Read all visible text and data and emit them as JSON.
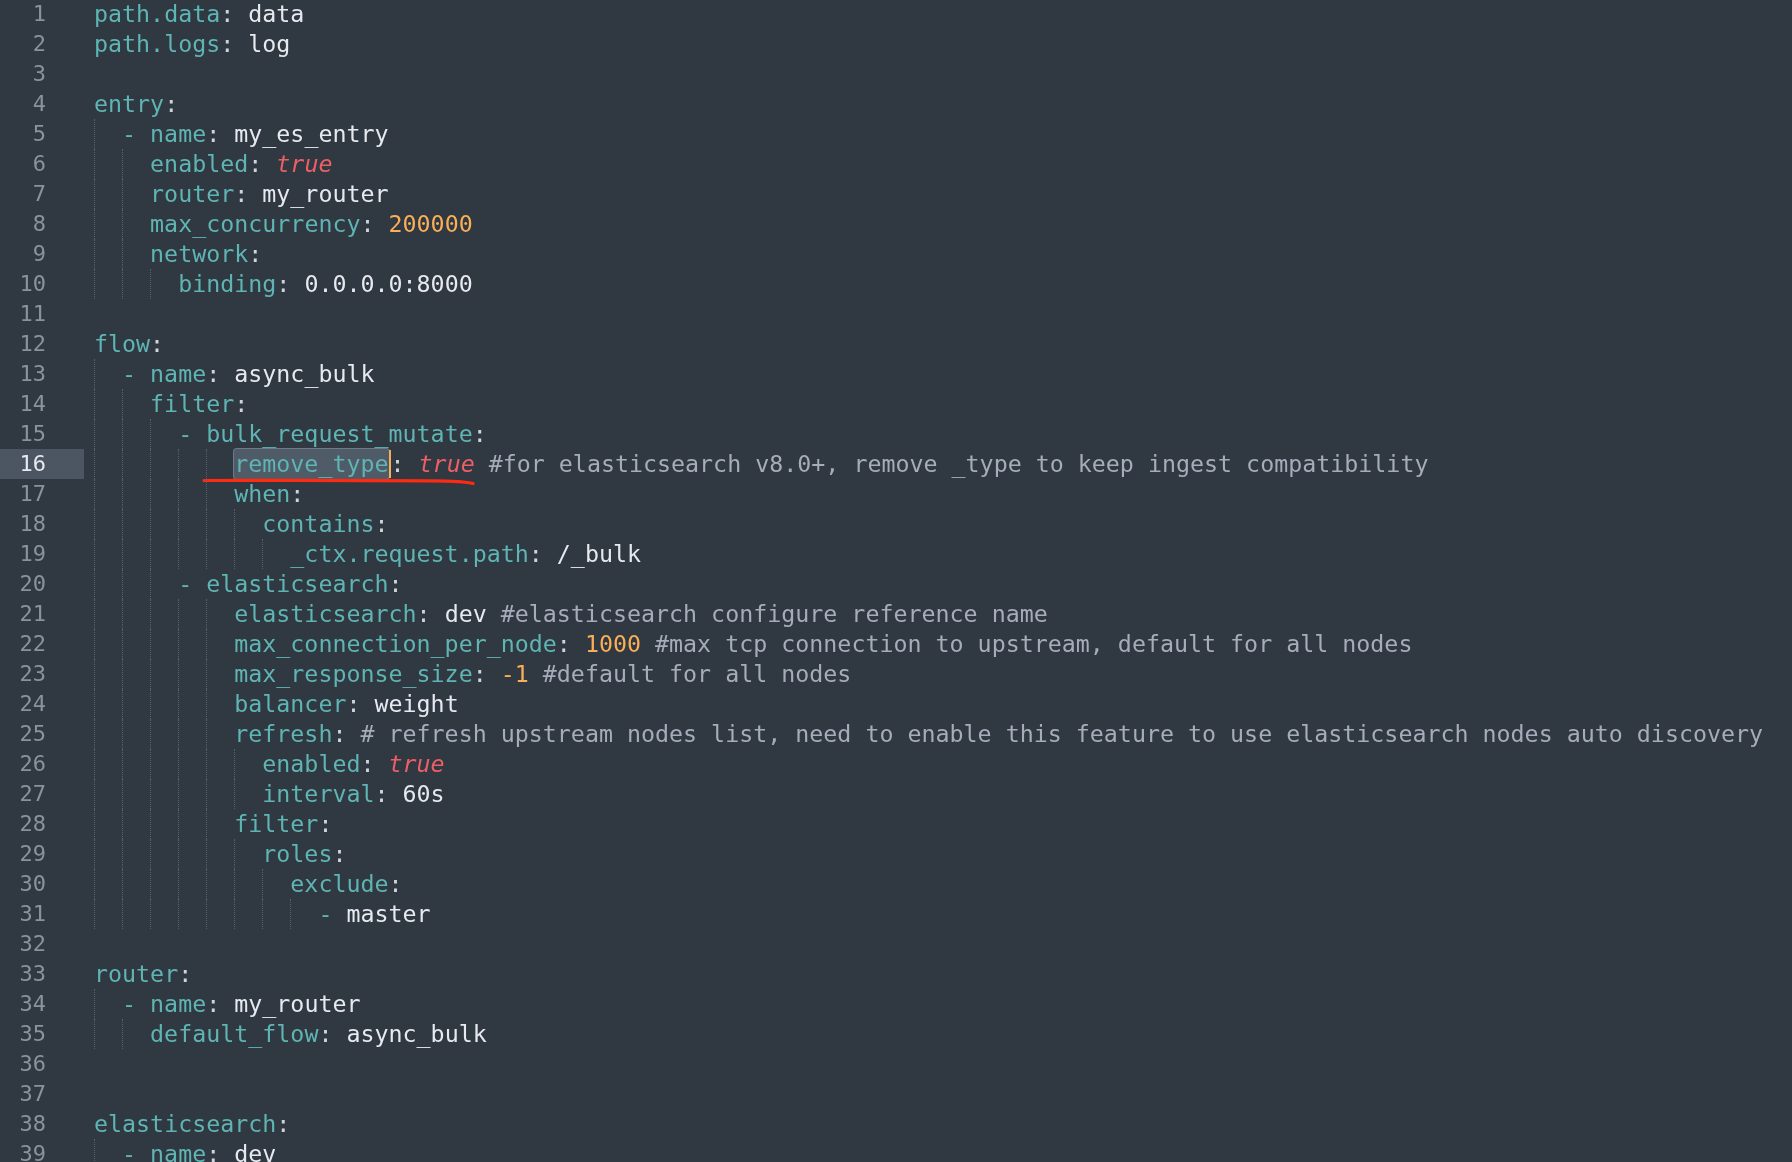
{
  "lines": [
    {
      "number": "1",
      "key": "path.data",
      "colon": ":",
      "value": {
        "kind": "plain",
        "text": "data"
      },
      "current": false
    },
    {
      "number": "2",
      "key": "path.logs",
      "colon": ":",
      "value": {
        "kind": "plain",
        "text": "log"
      },
      "current": false
    },
    {
      "number": "3",
      "current": false
    },
    {
      "number": "4",
      "key": "entry",
      "colon": ":",
      "current": false,
      "children": [
        {
          "number": "5",
          "dash": "-",
          "key": "name",
          "colon": ":",
          "value": {
            "kind": "plain",
            "text": "my_es_entry"
          },
          "current": false,
          "entries": [
            {
              "number": "6",
              "key": "enabled",
              "colon": ":",
              "value": {
                "kind": "bool",
                "text": "true"
              },
              "current": false
            },
            {
              "number": "7",
              "key": "router",
              "colon": ":",
              "value": {
                "kind": "plain",
                "text": "my_router"
              },
              "current": false
            },
            {
              "number": "8",
              "key": "max_concurrency",
              "colon": ":",
              "value": {
                "kind": "number",
                "text": "200000"
              },
              "current": false
            },
            {
              "number": "9",
              "key": "network",
              "colon": ":",
              "current": false,
              "children": [
                {
                  "number": "10",
                  "key": "binding",
                  "colon": ":",
                  "value": {
                    "kind": "plain",
                    "text": "0.0.0.0:8000"
                  },
                  "current": false
                }
              ]
            }
          ]
        }
      ]
    },
    {
      "number": "11",
      "current": false
    },
    {
      "number": "12",
      "key": "flow",
      "colon": ":",
      "current": false,
      "children": [
        {
          "number": "13",
          "dash": "-",
          "key": "name",
          "colon": ":",
          "value": {
            "kind": "plain",
            "text": "async_bulk"
          },
          "current": false,
          "entries": [
            {
              "number": "14",
              "key": "filter",
              "colon": ":",
              "current": false,
              "children": [
                {
                  "number": "15",
                  "dash": "-",
                  "key": "bulk_request_mutate",
                  "colon": ":",
                  "current": false,
                  "children": [
                    {
                      "number": "16",
                      "key": "remove_type",
                      "colon": ":",
                      "value": {
                        "kind": "bool",
                        "text": "true"
                      },
                      "comment": "#for elasticsearch v8.0+, remove _type to keep ingest compatibility",
                      "current": true,
                      "annotation": {
                        "kind": "underline"
                      }
                    },
                    {
                      "number": "17",
                      "key": "when",
                      "colon": ":",
                      "current": false,
                      "children": [
                        {
                          "number": "18",
                          "key": "contains",
                          "colon": ":",
                          "current": false,
                          "children": [
                            {
                              "number": "19",
                              "key": "_ctx.request.path",
                              "colon": ":",
                              "value": {
                                "kind": "plain",
                                "text": "/_bulk"
                              },
                              "current": false
                            }
                          ]
                        }
                      ]
                    }
                  ]
                },
                {
                  "number": "20",
                  "dash": "-",
                  "key": "elasticsearch",
                  "colon": ":",
                  "current": false,
                  "children": [
                    {
                      "number": "21",
                      "key": "elasticsearch",
                      "colon": ":",
                      "value": {
                        "kind": "plain",
                        "text": "dev"
                      },
                      "comment": "#elasticsearch configure reference name",
                      "current": false
                    },
                    {
                      "number": "22",
                      "key": "max_connection_per_node",
                      "colon": ":",
                      "value": {
                        "kind": "number",
                        "text": "1000"
                      },
                      "comment": "#max tcp connection to upstream, default for all nodes",
                      "current": false
                    },
                    {
                      "number": "23",
                      "key": "max_response_size",
                      "colon": ":",
                      "value": {
                        "kind": "number",
                        "text": "-1"
                      },
                      "comment": "#default for all nodes",
                      "current": false
                    },
                    {
                      "number": "24",
                      "key": "balancer",
                      "colon": ":",
                      "value": {
                        "kind": "plain",
                        "text": "weight"
                      },
                      "current": false
                    },
                    {
                      "number": "25",
                      "key": "refresh",
                      "colon": ":",
                      "comment": "# refresh upstream nodes list, need to enable this feature to use elasticsearch nodes auto discovery",
                      "current": false,
                      "children": [
                        {
                          "number": "26",
                          "key": "enabled",
                          "colon": ":",
                          "value": {
                            "kind": "bool",
                            "text": "true"
                          },
                          "current": false
                        },
                        {
                          "number": "27",
                          "key": "interval",
                          "colon": ":",
                          "value": {
                            "kind": "plain",
                            "text": "60s"
                          },
                          "current": false
                        }
                      ]
                    },
                    {
                      "number": "28",
                      "key": "filter",
                      "colon": ":",
                      "current": false,
                      "children": [
                        {
                          "number": "29",
                          "key": "roles",
                          "colon": ":",
                          "current": false,
                          "children": [
                            {
                              "number": "30",
                              "key": "exclude",
                              "colon": ":",
                              "current": false,
                              "children": [
                                {
                                  "number": "31",
                                  "dash": "-",
                                  "value": {
                                    "kind": "plain",
                                    "text": "master"
                                  },
                                  "current": false
                                }
                              ]
                            }
                          ]
                        }
                      ]
                    }
                  ]
                }
              ]
            }
          ]
        }
      ]
    },
    {
      "number": "32",
      "current": false
    },
    {
      "number": "33",
      "key": "router",
      "colon": ":",
      "current": false,
      "children": [
        {
          "number": "34",
          "dash": "-",
          "key": "name",
          "colon": ":",
          "value": {
            "kind": "plain",
            "text": "my_router"
          },
          "current": false,
          "entries": [
            {
              "number": "35",
              "key": "default_flow",
              "colon": ":",
              "value": {
                "kind": "plain",
                "text": "async_bulk"
              },
              "current": false
            }
          ]
        }
      ]
    },
    {
      "number": "36",
      "current": false
    },
    {
      "number": "37",
      "current": false
    },
    {
      "number": "38",
      "key": "elasticsearch",
      "colon": ":",
      "current": false,
      "children": [
        {
          "number": "39",
          "dash": "-",
          "key": "name",
          "colon": ":",
          "value": {
            "kind": "plain",
            "text": "dev"
          },
          "current": false
        }
      ]
    }
  ]
}
